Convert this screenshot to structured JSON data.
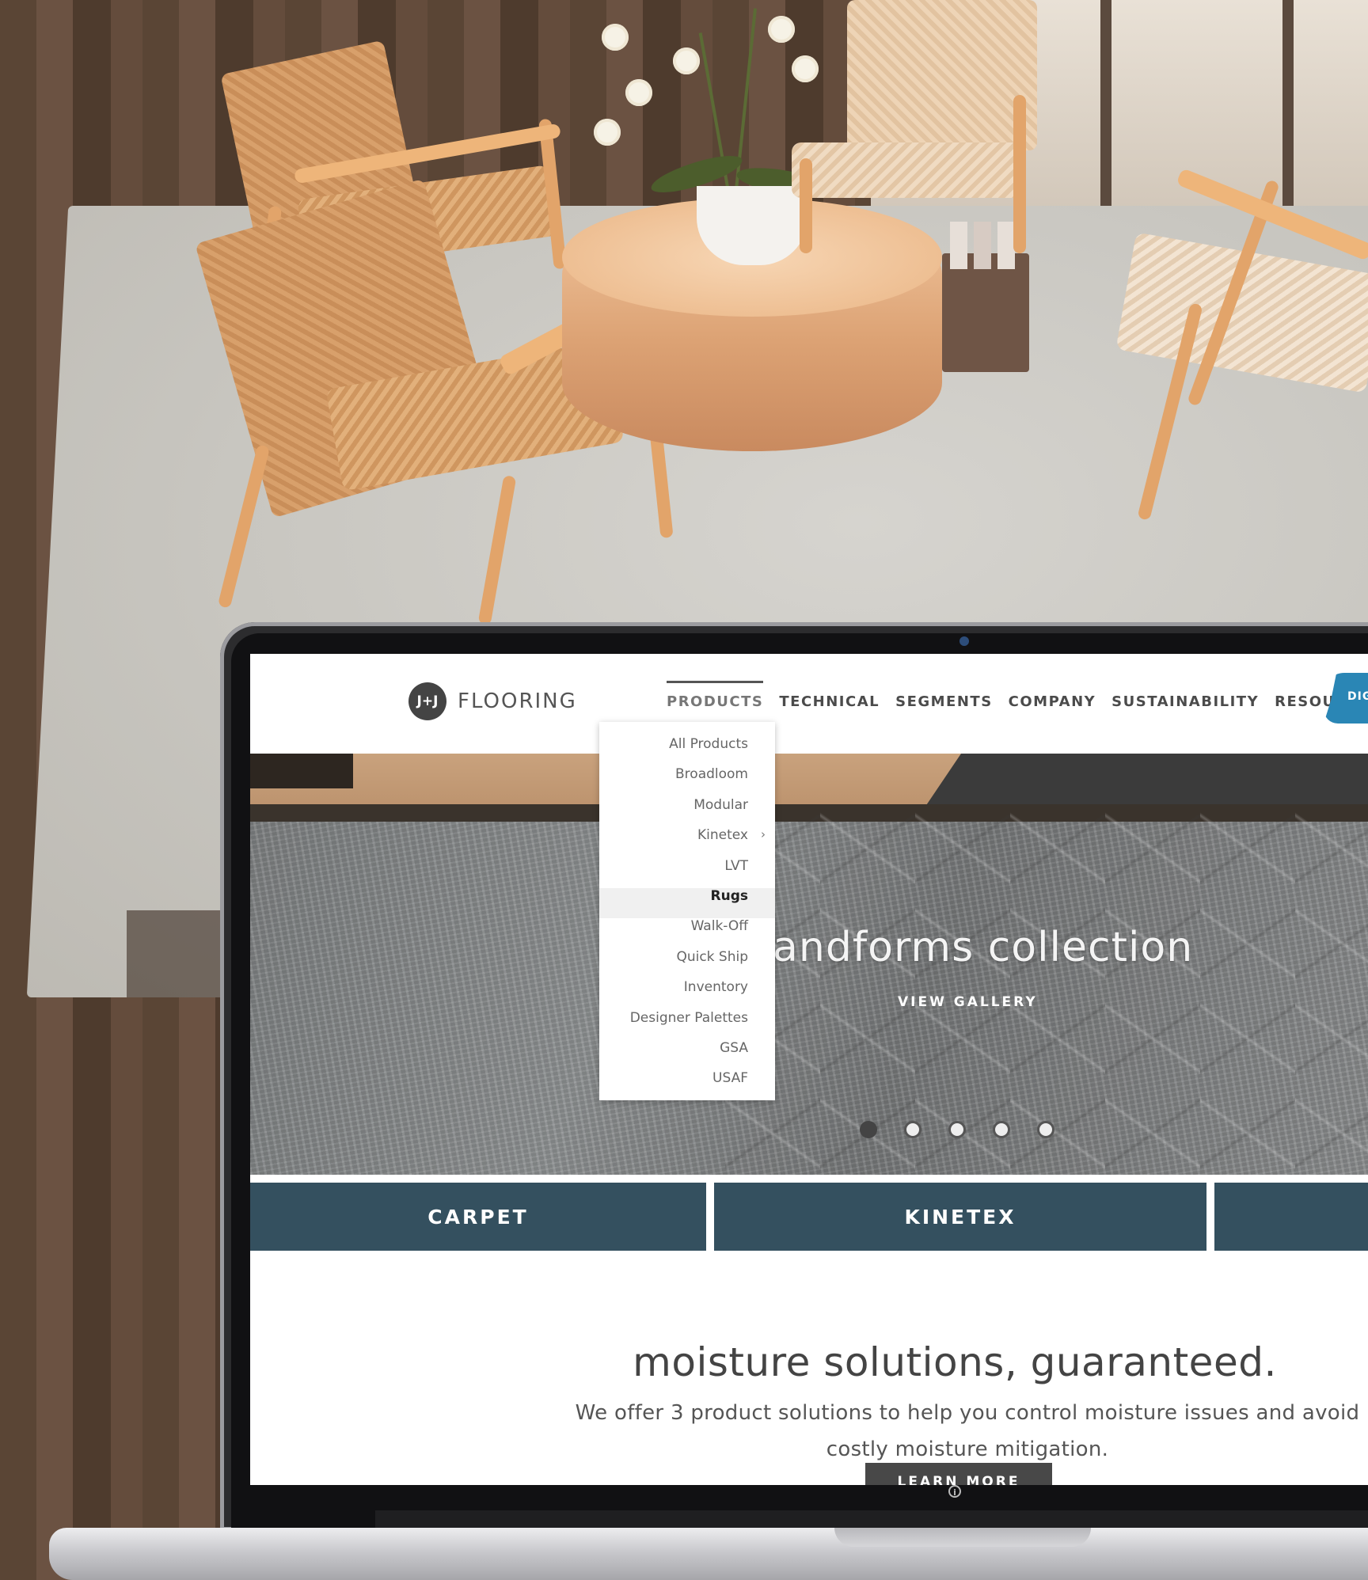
{
  "brand": {
    "logo_mark": "J+J",
    "logo_word": "FLOORING"
  },
  "nav": {
    "items": [
      {
        "label": "PRODUCTS",
        "active": true
      },
      {
        "label": "TECHNICAL"
      },
      {
        "label": "SEGMENTS"
      },
      {
        "label": "COMPANY"
      },
      {
        "label": "SUSTAINABILITY"
      },
      {
        "label": "RESOURCES"
      }
    ],
    "badge_label": "DIGI"
  },
  "products_menu": {
    "options": [
      {
        "label": "All Products"
      },
      {
        "label": "Broadloom"
      },
      {
        "label": "Modular"
      },
      {
        "label": "Kinetex",
        "has_submenu": true
      },
      {
        "label": "LVT"
      },
      {
        "label": "Rugs",
        "selected": true
      },
      {
        "label": "Walk-Off"
      },
      {
        "label": "Quick Ship"
      },
      {
        "label": "Inventory"
      },
      {
        "label": "Designer Palettes"
      },
      {
        "label": "GSA"
      },
      {
        "label": "USAF"
      }
    ],
    "chevron": "›"
  },
  "hero": {
    "title": "andforms collection",
    "link": "VIEW GALLERY",
    "slides": 5,
    "active_slide": 1
  },
  "categories": [
    {
      "label": "CARPET"
    },
    {
      "label": "KINETEX"
    },
    {
      "label": ""
    }
  ],
  "promo": {
    "headline": "moisture solutions, guaranteed.",
    "body": "We offer 3 product solutions to help you control moisture issues and avoid costly moisture mitigation.",
    "button": "LEARN MORE"
  },
  "info_icon": "i",
  "colors": {
    "category_bar": "#34505f",
    "accent_badge": "#2a86b5",
    "button": "#484848"
  }
}
